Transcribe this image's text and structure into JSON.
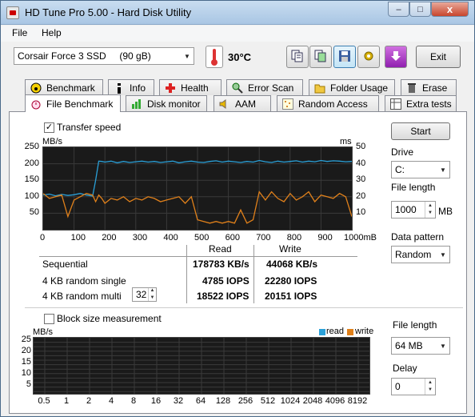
{
  "window": {
    "title": "HD Tune Pro 5.00 - Hard Disk Utility",
    "minimize": "–",
    "maximize": "□",
    "close": "x"
  },
  "menu": {
    "file": "File",
    "help": "Help"
  },
  "toolbar": {
    "drive_select": "Corsair Force 3 SSD     (90 gB)",
    "temperature": "30°C",
    "exit_label": "Exit"
  },
  "tabs_top": [
    "Benchmark",
    "Info",
    "Health",
    "Error Scan",
    "Folder Usage",
    "Erase"
  ],
  "tabs_bottom": [
    "File Benchmark",
    "Disk monitor",
    "AAM",
    "Random Access",
    "Extra tests"
  ],
  "active_tab": "File Benchmark",
  "transfer": {
    "checkbox_label": "Transfer speed",
    "checked": true,
    "y_left_unit": "MB/s",
    "y_right_unit": "ms",
    "y_left_ticks": [
      "250",
      "200",
      "150",
      "100",
      "50"
    ],
    "y_right_ticks": [
      "50",
      "40",
      "30",
      "20",
      "10"
    ],
    "x_ticks": [
      "0",
      "100",
      "200",
      "300",
      "400",
      "500",
      "600",
      "700",
      "800",
      "900",
      "1000mB"
    ]
  },
  "results": {
    "col_read": "Read",
    "col_write": "Write",
    "rows": [
      {
        "label": "Sequential",
        "read": "178783 KB/s",
        "write": "44068 KB/s"
      },
      {
        "label": "4 KB random single",
        "read": "4785 IOPS",
        "write": "22280 IOPS"
      },
      {
        "label": "4 KB random multi",
        "queue": "32",
        "read": "18522 IOPS",
        "write": "20151 IOPS"
      }
    ]
  },
  "right_panel": {
    "start_label": "Start",
    "drive_label": "Drive",
    "drive_value": "C:",
    "file_length_label": "File length",
    "file_length_value": "1000",
    "file_length_unit": "MB",
    "data_pattern_label": "Data pattern",
    "data_pattern_value": "Random"
  },
  "block": {
    "checkbox_label": "Block size measurement",
    "checked": false,
    "y_unit": "MB/s",
    "y_ticks": [
      "25",
      "20",
      "15",
      "10",
      "5"
    ],
    "x_ticks": [
      "0.5",
      "1",
      "2",
      "4",
      "8",
      "16",
      "32",
      "64",
      "128",
      "256",
      "512",
      "1024",
      "2048",
      "4096",
      "8192"
    ],
    "legend_read": "read",
    "legend_write": "write",
    "file_length_label": "File length",
    "file_length_value": "64 MB",
    "delay_label": "Delay",
    "delay_value": "0"
  },
  "colors": {
    "read": "#2aa0d8",
    "write": "#e0801a",
    "graph_bg": "#1a1a1a",
    "grid": "#3a3a3a"
  },
  "chart_data": {
    "type": "line",
    "title": "",
    "xlabel": "",
    "xlim": [
      0,
      1000
    ],
    "ylim_left": [
      0,
      250
    ],
    "ylim_right": [
      0,
      50
    ],
    "grid": true,
    "series": [
      {
        "name": "",
        "axis": "left",
        "x": [
          0,
          20,
          40,
          60,
          80,
          100,
          120,
          140,
          160,
          170,
          180,
          190,
          200,
          220,
          240,
          260,
          280,
          300,
          320,
          340,
          360,
          380,
          400,
          420,
          440,
          460,
          480,
          500,
          520,
          540,
          560,
          580,
          600,
          620,
          640,
          660,
          680,
          700,
          720,
          740,
          760,
          780,
          800,
          820,
          840,
          860,
          880,
          900,
          920,
          940,
          960,
          980,
          1000
        ],
        "y": [
          105,
          108,
          103,
          107,
          104,
          106,
          110,
          105,
          102,
          150,
          208,
          207,
          205,
          208,
          203,
          207,
          204,
          206,
          208,
          205,
          207,
          204,
          206,
          208,
          203,
          206,
          208,
          205,
          204,
          207,
          209,
          205,
          208,
          206,
          204,
          207,
          205,
          210,
          206,
          204,
          208,
          205,
          207,
          209,
          205,
          208,
          206,
          210,
          207,
          209,
          208,
          206,
          207
        ]
      },
      {
        "name": "",
        "axis": "right",
        "x": [
          0,
          20,
          40,
          60,
          80,
          100,
          120,
          140,
          160,
          170,
          180,
          190,
          200,
          220,
          240,
          260,
          280,
          300,
          320,
          340,
          360,
          380,
          400,
          420,
          440,
          460,
          480,
          500,
          520,
          540,
          560,
          580,
          600,
          620,
          640,
          660,
          680,
          700,
          720,
          740,
          760,
          780,
          800,
          820,
          840,
          860,
          880,
          900,
          920,
          940,
          960,
          980,
          1000
        ],
        "y": [
          22,
          19,
          20,
          21,
          8,
          18,
          20,
          22,
          21,
          17,
          21,
          19,
          16,
          19,
          18,
          20,
          17,
          19,
          18,
          20,
          19,
          17,
          18,
          19,
          20,
          16,
          20,
          6,
          5,
          4,
          5,
          4,
          5,
          4,
          12,
          4,
          6,
          23,
          18,
          23,
          19,
          17,
          22,
          18,
          20,
          23,
          17,
          21,
          20,
          19,
          22,
          20,
          8
        ]
      }
    ]
  }
}
